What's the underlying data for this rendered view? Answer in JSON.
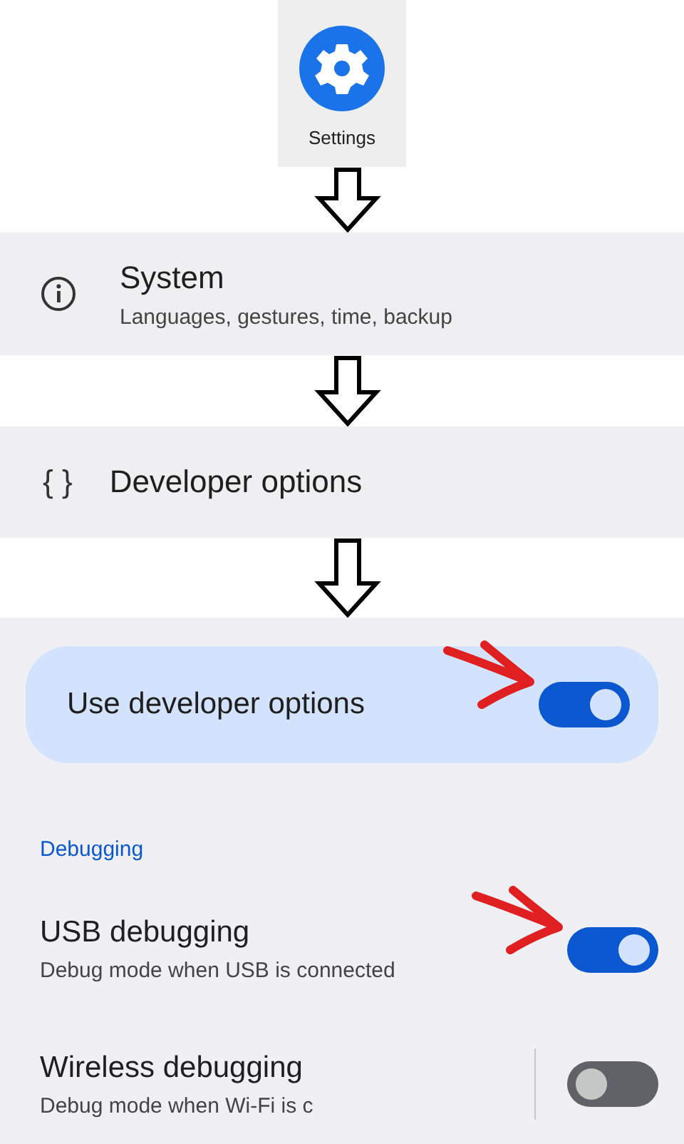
{
  "app_tile": {
    "label": "Settings"
  },
  "steps": [
    {
      "kind": "info",
      "title": "System",
      "subtitle": "Languages, gestures, time, backup"
    },
    {
      "kind": "braces",
      "icon_text": "{ }",
      "title": "Developer options"
    }
  ],
  "developer_panel": {
    "master": {
      "label": "Use developer options",
      "on": true,
      "pointer": true
    },
    "section": "Debugging",
    "items": [
      {
        "title": "USB debugging",
        "subtitle": "Debug mode when USB is connected",
        "on": true,
        "pointer": true,
        "divider": false
      },
      {
        "title": "Wireless debugging",
        "subtitle": "Debug mode when Wi-Fi is c",
        "on": false,
        "pointer": false,
        "divider": true
      }
    ]
  }
}
